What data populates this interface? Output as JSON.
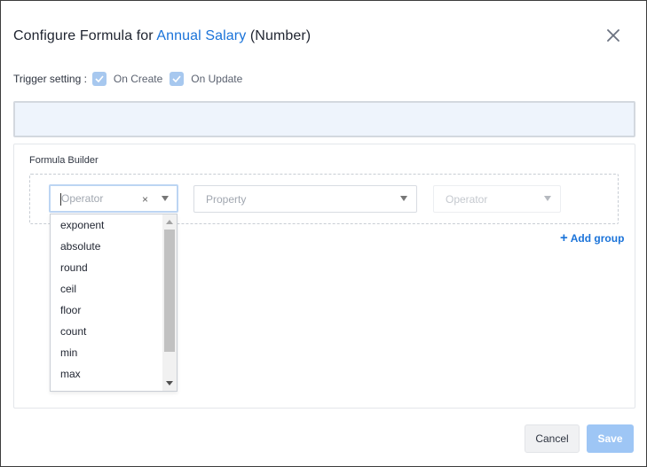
{
  "dialog": {
    "title_prefix": "Configure Formula for ",
    "title_field": "Annual Salary",
    "title_suffix": " (Number)",
    "accent_color": "#1a73d9"
  },
  "trigger": {
    "label": "Trigger setting :",
    "options": [
      {
        "label": "On Create",
        "checked": true
      },
      {
        "label": "On Update",
        "checked": true
      }
    ]
  },
  "builder": {
    "title": "Formula Builder",
    "operator_placeholder": "Operator",
    "property_placeholder": "Property",
    "operator2_placeholder": "Operator",
    "clear_glyph": "×",
    "add_group_label": "Add group"
  },
  "dropdown": {
    "items": [
      "exponent",
      "absolute",
      "round",
      "ceil",
      "floor",
      "count",
      "min",
      "max"
    ]
  },
  "footer": {
    "cancel_label": "Cancel",
    "save_label": "Save",
    "save_color": "#9ec6f5"
  },
  "icons": {
    "close": "close-icon",
    "check": "check-icon",
    "chevron": "chevron-down-icon",
    "plus": "plus-icon"
  }
}
